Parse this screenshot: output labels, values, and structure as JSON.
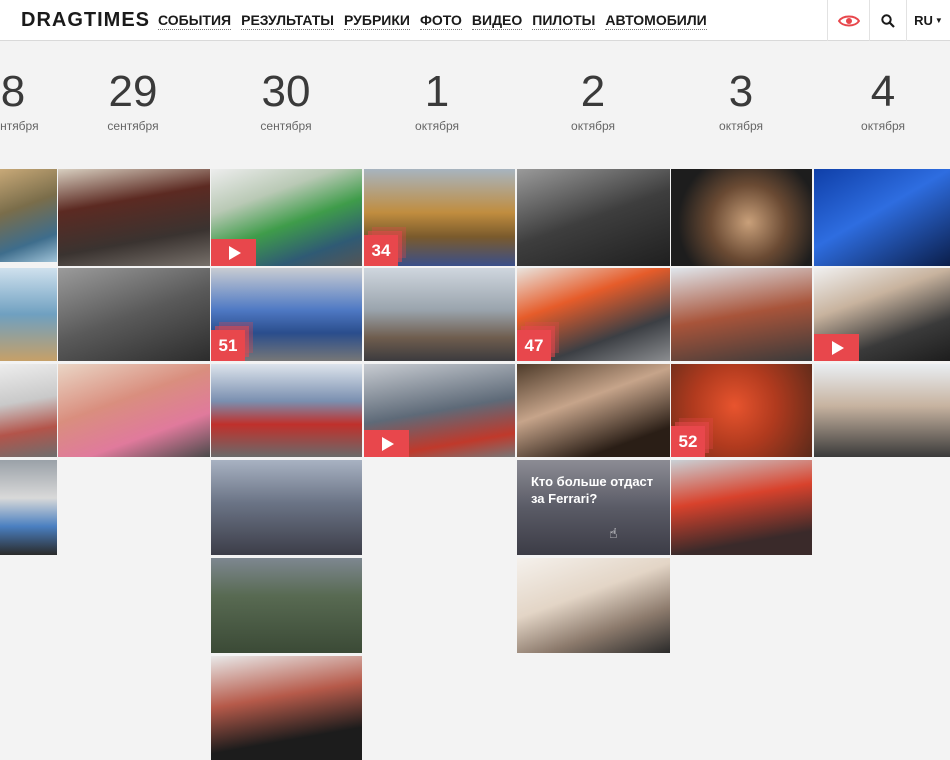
{
  "header": {
    "logo": "DRAGTIMES",
    "nav": [
      "СОБЫТИЯ",
      "РЕЗУЛЬТАТЫ",
      "РУБРИКИ",
      "ФОТО",
      "ВИДЕО",
      "ПИЛОТЫ",
      "АВТОМОБИЛИ"
    ],
    "lang": "RU",
    "icons": {
      "eye": "eye-icon",
      "search": "search-icon",
      "caret": "caret-down-icon"
    },
    "accent": "#e8474c"
  },
  "dates": [
    {
      "num": "8",
      "mon": "сентября"
    },
    {
      "num": "29",
      "mon": "сентября"
    },
    {
      "num": "30",
      "mon": "сентября"
    },
    {
      "num": "1",
      "mon": "октября"
    },
    {
      "num": "2",
      "mon": "октября"
    },
    {
      "num": "3",
      "mon": "октября"
    },
    {
      "num": "4",
      "mon": "октября"
    }
  ],
  "tiles": {
    "t30_1": {
      "badge": "",
      "video": true
    },
    "t1_1": {
      "badge": "34"
    },
    "t30_2": {
      "badge": "51"
    },
    "t2_2": {
      "badge": "47"
    },
    "t4_2": {
      "badge": "",
      "video": true
    },
    "t1_3": {
      "badge": "",
      "video": true
    },
    "t3_3": {
      "badge": "52"
    },
    "t2_4": {
      "caption": "Кто больше отдаст за Ferrari?"
    }
  }
}
